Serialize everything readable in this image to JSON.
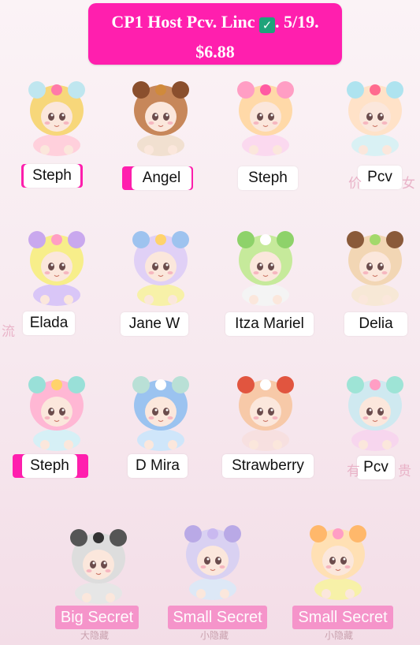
{
  "header": {
    "line1": "CP1 Host Pcv. Linc",
    "check": "✓",
    "line1_tail": ". 5/19.",
    "line2": "$6.88"
  },
  "cards": [
    {
      "label": "Steph"
    },
    {
      "label": "Angel"
    },
    {
      "label": "Steph"
    },
    {
      "label": "Pcv"
    },
    {
      "label": "Elada"
    },
    {
      "label": "Jane W"
    },
    {
      "label": "Itza Mariel"
    },
    {
      "label": "Delia"
    },
    {
      "label": "Steph"
    },
    {
      "label": "D Mira"
    },
    {
      "label": "Strawberry"
    },
    {
      "label": "Pcv"
    }
  ],
  "secrets": [
    {
      "label": "Big Secret",
      "sub": "大隐藏"
    },
    {
      "label": "Small Secret",
      "sub": "小隐藏"
    },
    {
      "label": "Small Secret",
      "sub": "小隐藏"
    }
  ],
  "ghost_text": {
    "r1c4": "价",
    "r1c4b": "女",
    "r2c1": "流",
    "r3c4": "有",
    "r3c4b": "贵"
  },
  "colors": {
    "accent": "#ff1fae",
    "secret": "#f68ec8"
  }
}
